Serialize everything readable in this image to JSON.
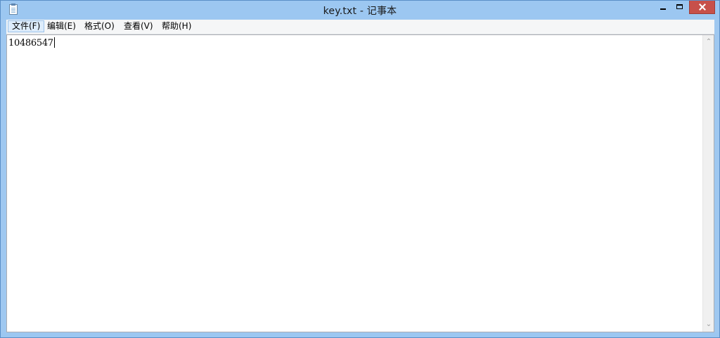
{
  "window": {
    "title": "key.txt - 记事本",
    "icon": "notepad-icon",
    "controls": {
      "minimize_icon": "minimize-icon",
      "maximize_icon": "maximize-icon",
      "close_icon": "close-icon",
      "close_color": "#c7504a"
    }
  },
  "menubar": {
    "items": [
      {
        "label": "文件(F)",
        "active": true
      },
      {
        "label": "编辑(E)",
        "active": false
      },
      {
        "label": "格式(O)",
        "active": false
      },
      {
        "label": "查看(V)",
        "active": false
      },
      {
        "label": "帮助(H)",
        "active": false
      }
    ]
  },
  "editor": {
    "content": "10486547"
  },
  "scrollbar": {
    "up_glyph": "⌃",
    "down_glyph": "⌄"
  },
  "colors": {
    "titlebar": "#9cc7f1",
    "menu_active_bg": "#ddecfb",
    "menu_active_border": "#9cc3ea"
  }
}
